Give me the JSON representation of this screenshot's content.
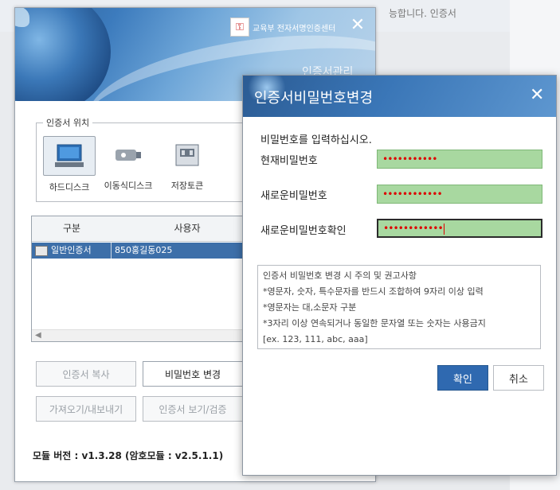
{
  "background": {
    "text": "능합니다. 인증서"
  },
  "main": {
    "brand_text": "교육부 전자서명인증센터",
    "subtitle": "인증서관리",
    "location_legend": "인증서 위치",
    "locations": [
      {
        "label": "하드디스크",
        "icon": "hard-disk-icon",
        "selected": true
      },
      {
        "label": "이동식디스크",
        "icon": "usb-drive-icon",
        "selected": false
      },
      {
        "label": "저장토큰",
        "icon": "security-token-icon",
        "selected": false
      }
    ],
    "table": {
      "headers": [
        "구분",
        "사용자"
      ],
      "rows": [
        {
          "type": "일반인증서",
          "user": "850홍길동025",
          "selected": true
        }
      ]
    },
    "buttons": {
      "copy": "인증서 복사",
      "change_password": "비밀번호 변경",
      "import_export": "가져오기/내보내기",
      "view_verify": "인증서 보기/검증"
    },
    "version": "모듈 버전 : v1.3.28 (암호모듈 : v2.5.1.1)",
    "close": "닫기"
  },
  "dialog": {
    "title": "인증서비밀번호변경",
    "prompt": "비밀번호를 입력하십시오.",
    "fields": [
      {
        "label": "현재비밀번호",
        "value": "•••••••••••"
      },
      {
        "label": "새로운비밀번호",
        "value": "••••••••••••"
      },
      {
        "label": "새로운비밀번호확인",
        "value": "••••••••••••"
      }
    ],
    "notice": [
      "인증서 비밀번호 변경 시 주의 및 권고사항",
      "*영문자, 숫자, 특수문자를 반드시 조합하여 9자리 이상 입력",
      "*영문자는 대,소문자 구분",
      "*3자리 이상 연속되거나 동일한 문자열 또는 숫자는 사용금지",
      " [ex. 123, 111, abc, aaa]"
    ],
    "ok": "확인",
    "cancel": "취소"
  },
  "colors": {
    "accent": "#2f69b0",
    "field_bg": "#a8d8a0",
    "selected_row": "#3d6fa9"
  }
}
